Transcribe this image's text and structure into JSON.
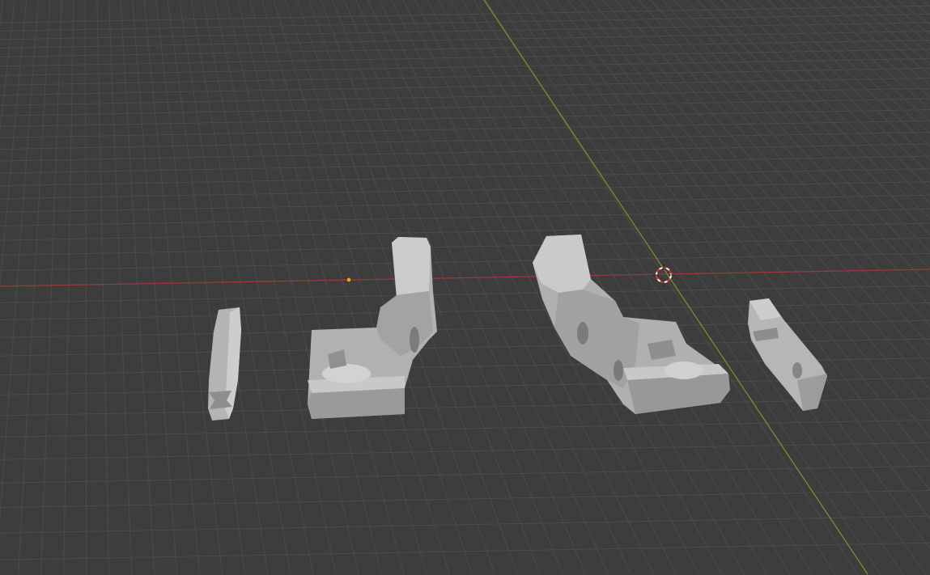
{
  "viewport": {
    "colors": {
      "background": "#3d3d3d",
      "grid_line": "#4c4c4c",
      "x_axis": "#a0383d",
      "y_axis": "#6f9a2c",
      "object_light": "#c4c4c4",
      "object_mid": "#a9a9a9",
      "object_dark": "#8c8c8c",
      "origin_dot": "#f0a030"
    },
    "icons": {
      "cursor": "3d-cursor-icon",
      "origin": "object-origin-icon"
    }
  }
}
